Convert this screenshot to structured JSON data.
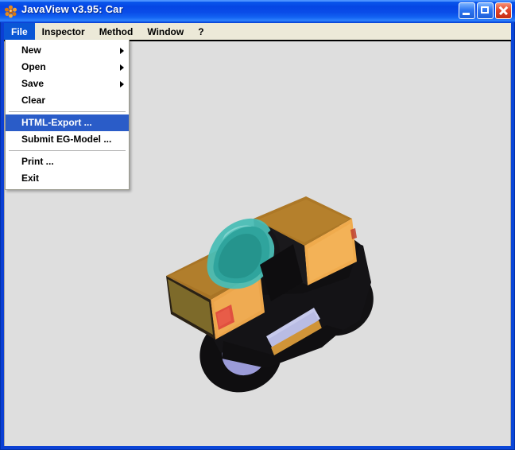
{
  "window": {
    "title": "JavaView v3.95: Car",
    "app_icon": "javaview-cluster-icon",
    "accent_color": "#0a46d8",
    "titlebar_color": "#0546e4",
    "menubar_color": "#ece9d8",
    "canvas_color": "#dedede",
    "controls": {
      "minimize_label": "Minimize",
      "maximize_label": "Maximize",
      "close_label": "Close"
    }
  },
  "menubar": {
    "items": [
      {
        "label": "File",
        "active": true
      },
      {
        "label": "Inspector",
        "active": false
      },
      {
        "label": "Method",
        "active": false
      },
      {
        "label": "Window",
        "active": false
      },
      {
        "label": "?",
        "active": false
      }
    ]
  },
  "file_menu": {
    "open": true,
    "highlight_color": "#2a5cc8",
    "items": [
      {
        "label": "New",
        "submenu": true,
        "selected": false,
        "type": "item"
      },
      {
        "label": "Open",
        "submenu": true,
        "selected": false,
        "type": "item"
      },
      {
        "label": "Save",
        "submenu": true,
        "selected": false,
        "type": "item"
      },
      {
        "label": "Clear",
        "submenu": false,
        "selected": false,
        "type": "item"
      },
      {
        "label": "",
        "submenu": false,
        "selected": false,
        "type": "separator"
      },
      {
        "label": "HTML-Export ...",
        "submenu": false,
        "selected": true,
        "type": "item"
      },
      {
        "label": "Submit EG-Model ...",
        "submenu": false,
        "selected": false,
        "type": "item"
      },
      {
        "label": "",
        "submenu": false,
        "selected": false,
        "type": "separator"
      },
      {
        "label": "Print ...",
        "submenu": false,
        "selected": false,
        "type": "item"
      },
      {
        "label": "Exit",
        "submenu": false,
        "selected": false,
        "type": "item"
      }
    ]
  },
  "viewport": {
    "model_name": "Car",
    "background_color": "#dedede",
    "model_colors": {
      "body_orange": "#eba94e",
      "body_orange_light": "#f3b45f",
      "hood_amber": "#b07a28",
      "hood_amber_dark": "#9a6a22",
      "chassis_black": "#100f10",
      "windshield_teal": "#3fb3ad",
      "windshield_teal_dark": "#1f8f89",
      "wheel_hub_periwinkle": "#9b9bd8",
      "taillight_red": "#e0503f",
      "running_board": "#c3c6ea"
    }
  }
}
